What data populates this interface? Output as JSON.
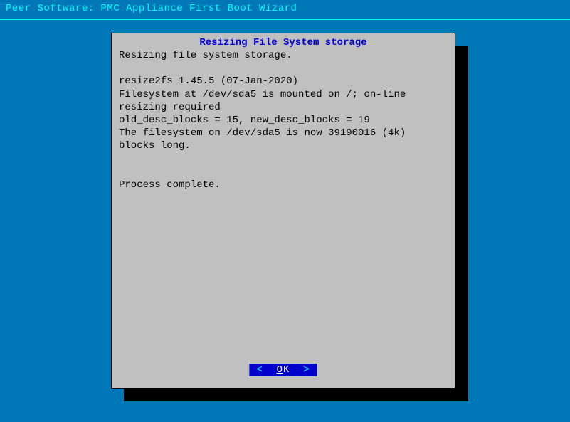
{
  "header": {
    "title": "Peer Software: PMC Appliance First Boot Wizard"
  },
  "dialog": {
    "title": "Resizing File System storage",
    "body_lines": [
      "Resizing file system storage.",
      "",
      "resize2fs 1.45.5 (07-Jan-2020)",
      "Filesystem at /dev/sda5 is mounted on /; on-line resizing required",
      "old_desc_blocks = 15, new_desc_blocks = 19",
      "The filesystem on /dev/sda5 is now 39190016 (4k) blocks long.",
      "",
      "",
      "Process complete."
    ],
    "ok_label": "OK"
  },
  "colors": {
    "background": "#0078b8",
    "accent": "#00ffff",
    "button_bg": "#0000cc",
    "title_fg": "#0000cc"
  }
}
